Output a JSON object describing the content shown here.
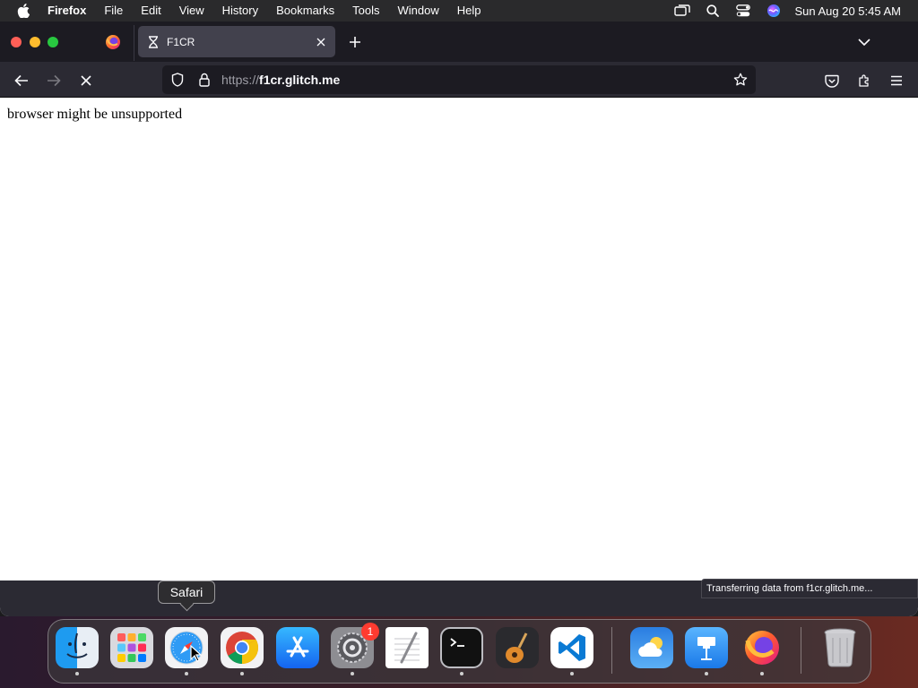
{
  "menubar": {
    "app_name": "Firefox",
    "menus": [
      "File",
      "Edit",
      "View",
      "History",
      "Bookmarks",
      "Tools",
      "Window",
      "Help"
    ],
    "clock": "Sun Aug 20  5:45 AM",
    "status_icons": [
      "screen-mirroring-icon",
      "search-icon",
      "control-center-icon",
      "siri-icon"
    ]
  },
  "browser": {
    "tab_title": "F1CR",
    "tab_icon": "hourglass-icon",
    "url_scheme": "https://",
    "url_host": "f1cr.glitch.me",
    "page_text": "browser might be unsupported",
    "status_text": "Transferring data from f1cr.glitch.me..."
  },
  "dock": {
    "tooltip": "Safari",
    "items": [
      {
        "name": "Finder",
        "icon": "finder-icon",
        "running": true
      },
      {
        "name": "Launchpad",
        "icon": "launchpad-icon",
        "running": false
      },
      {
        "name": "Safari",
        "icon": "safari-icon",
        "running": true
      },
      {
        "name": "Google Chrome",
        "icon": "chrome-icon",
        "running": true
      },
      {
        "name": "App Store",
        "icon": "app-store-icon",
        "running": false
      },
      {
        "name": "System Settings",
        "icon": "settings-icon",
        "running": true,
        "badge": "1"
      },
      {
        "name": "TextEdit",
        "icon": "textedit-icon",
        "running": false
      },
      {
        "name": "Terminal",
        "icon": "terminal-icon",
        "running": true
      },
      {
        "name": "GarageBand",
        "icon": "garageband-icon",
        "running": false
      },
      {
        "name": "Visual Studio Code",
        "icon": "vscode-icon",
        "running": true
      },
      {
        "name": "Weather",
        "icon": "weather-icon",
        "running": false
      },
      {
        "name": "Keynote",
        "icon": "keynote-icon",
        "running": true
      },
      {
        "name": "Firefox",
        "icon": "firefox-icon",
        "running": true
      },
      {
        "name": "Trash",
        "icon": "trash-icon",
        "running": false
      }
    ]
  },
  "colors": {
    "tabstrip": "#1c1b22",
    "toolbar": "#2b2a33",
    "selected_tab": "#42414d",
    "badge": "#ff3b30"
  }
}
